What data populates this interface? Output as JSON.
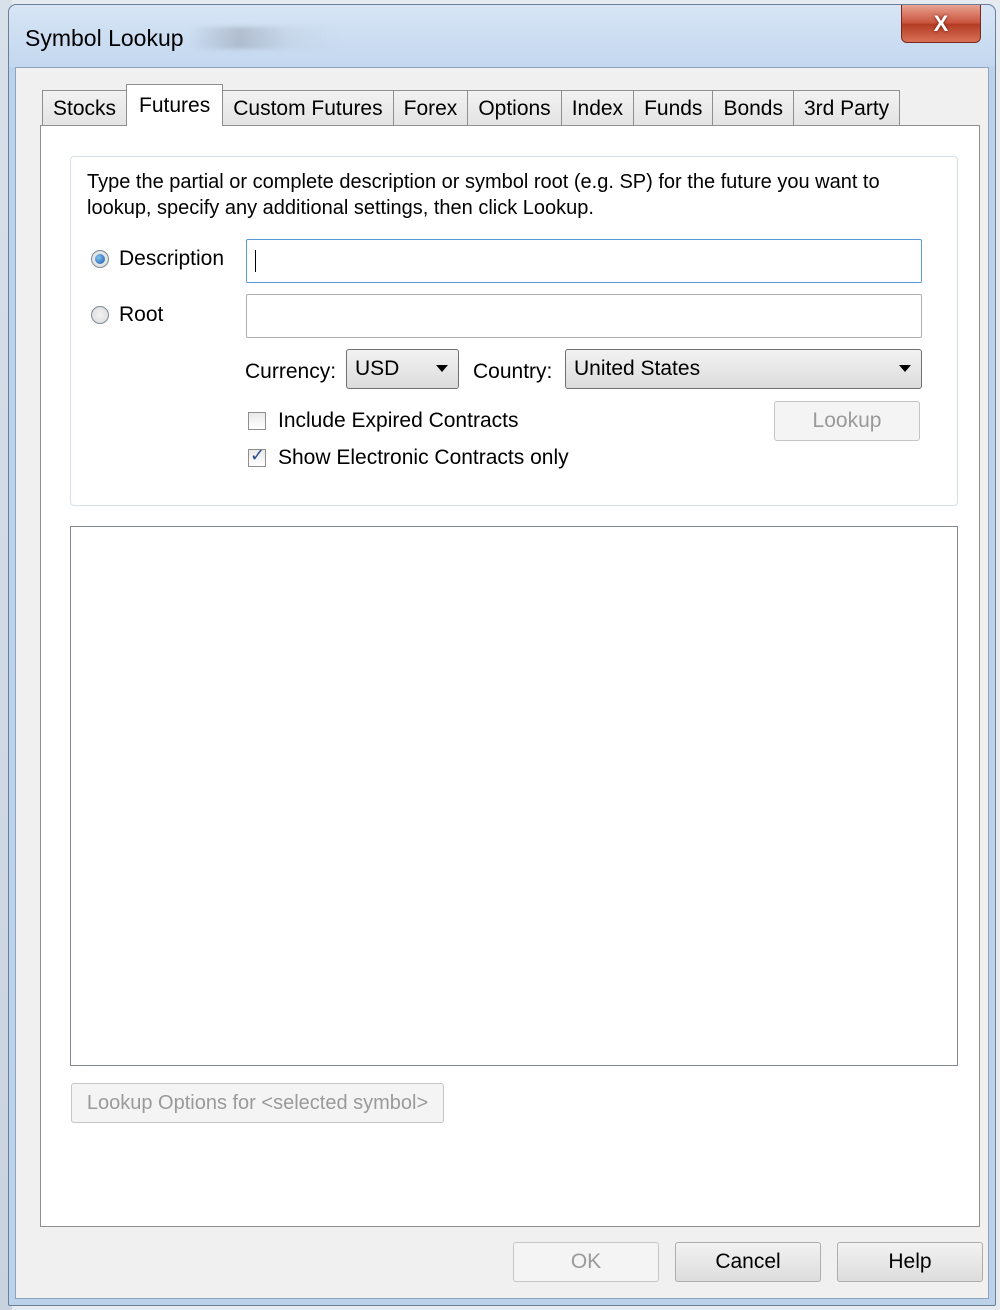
{
  "window": {
    "title": "Symbol Lookup",
    "close_label": "X"
  },
  "tabs": [
    {
      "label": "Stocks",
      "active": false
    },
    {
      "label": "Futures",
      "active": true
    },
    {
      "label": "Custom Futures",
      "active": false
    },
    {
      "label": "Forex",
      "active": false
    },
    {
      "label": "Options",
      "active": false
    },
    {
      "label": "Index",
      "active": false
    },
    {
      "label": "Funds",
      "active": false
    },
    {
      "label": "Bonds",
      "active": false
    },
    {
      "label": "3rd Party",
      "active": false
    }
  ],
  "search": {
    "instructions": "Type the partial or complete description or symbol root (e.g. SP) for the future you want to lookup, specify any additional settings, then click Lookup.",
    "mode_description_label": "Description",
    "mode_root_label": "Root",
    "selected_mode": "Description",
    "description_value": "",
    "root_value": "",
    "currency_label": "Currency:",
    "currency_value": "USD",
    "country_label": "Country:",
    "country_value": "United States",
    "include_expired_label": "Include Expired Contracts",
    "include_expired_checked": false,
    "electronic_only_label": "Show Electronic Contracts only",
    "electronic_only_checked": true,
    "lookup_button": "Lookup"
  },
  "results": {
    "rows": []
  },
  "lookup_options_button": "Lookup Options for <selected symbol>",
  "footer": {
    "ok_label": "OK",
    "cancel_label": "Cancel",
    "help_label": "Help"
  }
}
